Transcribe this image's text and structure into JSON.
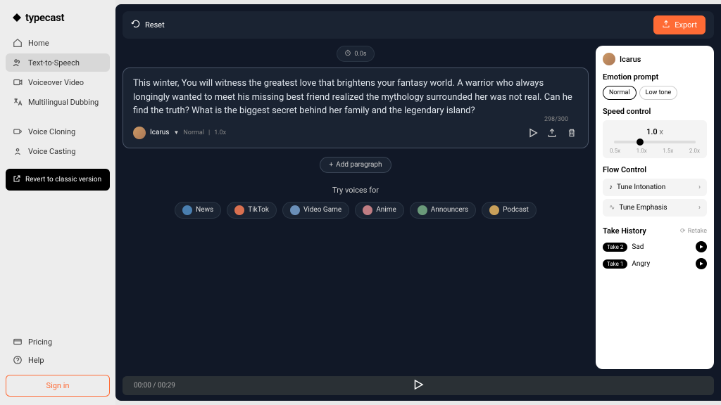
{
  "brand": "typecast",
  "sidebar": {
    "items": [
      {
        "label": "Home"
      },
      {
        "label": "Text-to-Speech"
      },
      {
        "label": "Voiceover Video"
      },
      {
        "label": "Multilingual Dubbing"
      },
      {
        "label": "Voice Cloning"
      },
      {
        "label": "Voice Casting"
      }
    ],
    "revert": "Revert to classic version",
    "pricing": "Pricing",
    "help": "Help",
    "signin": "Sign in"
  },
  "topbar": {
    "reset": "Reset",
    "export": "Export"
  },
  "editor": {
    "duration": "0.0s",
    "text": "This winter, You will witness the greatest love that brightens your fantasy world. A warrior who always longingly wanted to meet his missing best friend realized the mythology surrounded her was not real. Can he find the truth? What is the biggest secret behind her family and the legendary island?",
    "voice_name": "Icarus",
    "voice_emotion": "Normal",
    "voice_speed": "1.0x",
    "char_count": "298/300",
    "add_paragraph": "Add paragraph",
    "try_label": "Try voices for",
    "pills": [
      "News",
      "TikTok",
      "Video Game",
      "Anime",
      "Announcers",
      "Podcast"
    ]
  },
  "panel": {
    "voice": "Icarus",
    "emotion_title": "Emotion prompt",
    "emotions": [
      "Normal",
      "Low tone"
    ],
    "speed_title": "Speed control",
    "speed_value": "1.0",
    "speed_unit": "x",
    "speed_ticks": [
      "0.5x",
      "1.0x",
      "1.5x",
      "2.0x"
    ],
    "flow_title": "Flow Control",
    "flow_items": [
      "Tune Intonation",
      "Tune Emphasis"
    ],
    "history_title": "Take History",
    "retake": "Retake",
    "takes": [
      {
        "badge": "Take 2",
        "label": "Sad"
      },
      {
        "badge": "Take 1",
        "label": "Angry"
      }
    ]
  },
  "player": {
    "time": "00:00 / 00:29"
  },
  "colors": {
    "pill_dots": [
      "#4a7fb0",
      "#d97050",
      "#6a8fb8",
      "#c07d83",
      "#6a9a7a",
      "#c9a05a"
    ]
  }
}
